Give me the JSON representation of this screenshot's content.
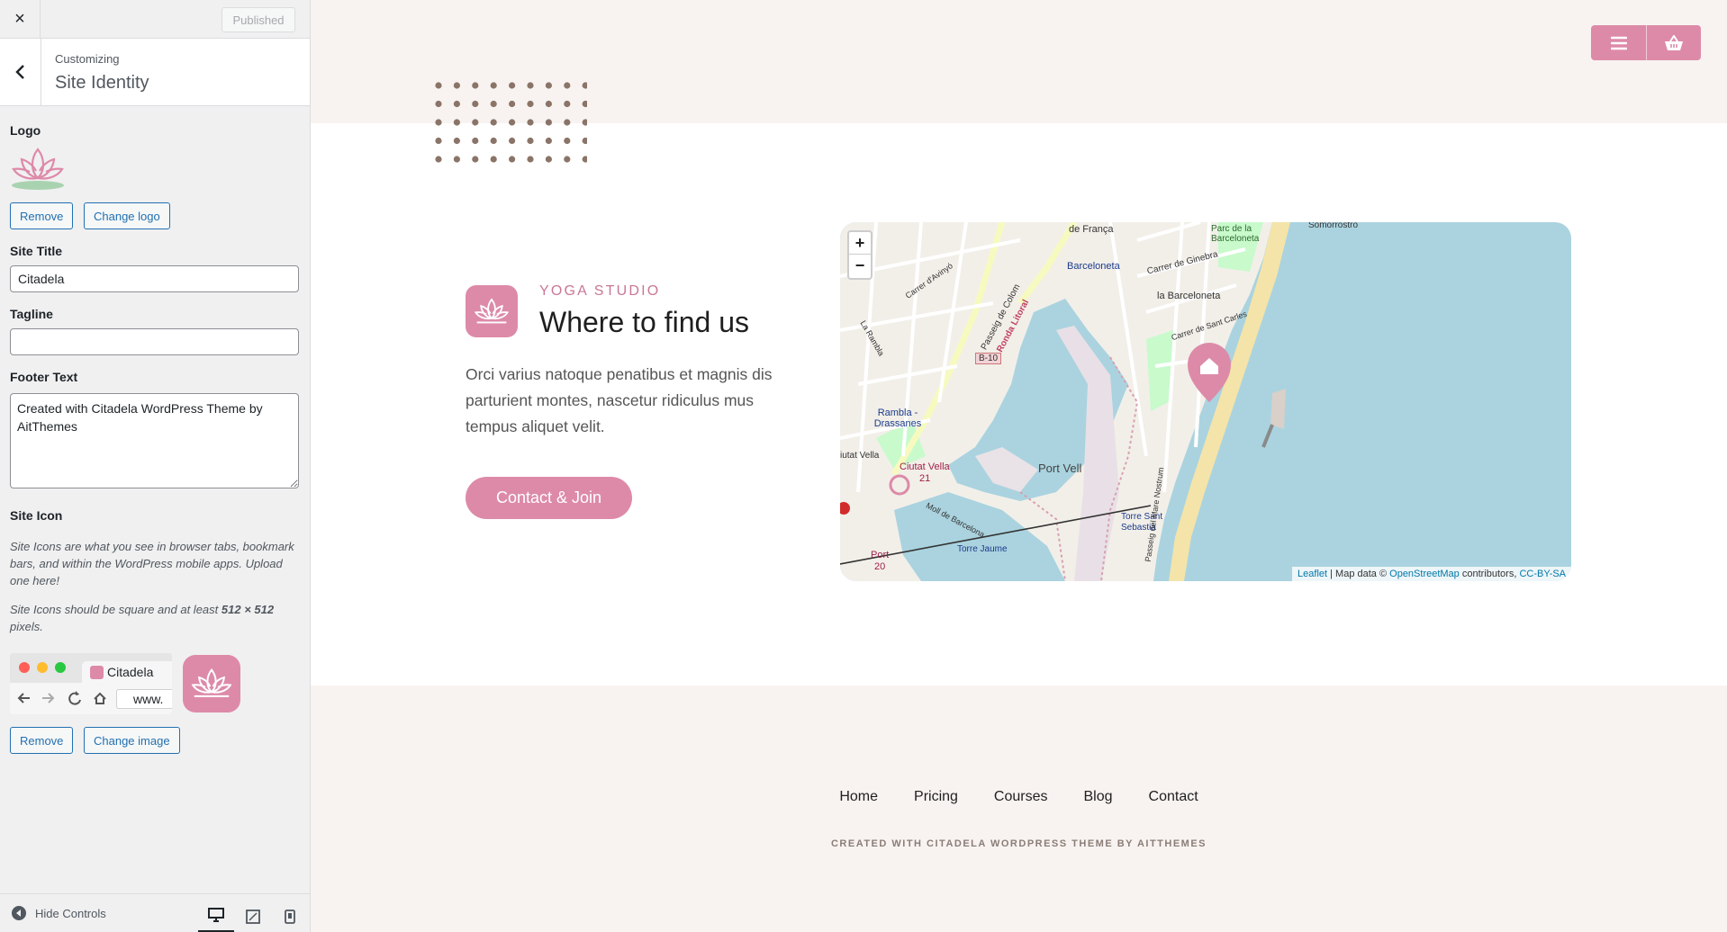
{
  "sidebar": {
    "close_label": "×",
    "published_label": "Published",
    "customizing_label": "Customizing",
    "section_name": "Site Identity",
    "logo_label": "Logo",
    "remove_logo_label": "Remove",
    "change_logo_label": "Change logo",
    "site_title_label": "Site Title",
    "site_title_value": "Citadela",
    "tagline_label": "Tagline",
    "tagline_value": "",
    "footer_text_label": "Footer Text",
    "footer_text_value": "Created with Citadela WordPress Theme by AitThemes",
    "site_icon_label": "Site Icon",
    "site_icon_desc": "Site Icons are what you see in browser tabs, bookmark bars, and within the WordPress mobile apps. Upload one here!",
    "site_icon_size_prefix": "Site Icons should be square and at least ",
    "site_icon_size_value": "512 × 512",
    "site_icon_size_suffix": " pixels.",
    "browser_tab_title": "Citadela",
    "browser_url": "www.",
    "remove_icon_label": "Remove",
    "change_image_label": "Change image",
    "hide_controls_label": "Hide Controls"
  },
  "preview": {
    "eyebrow": "YOGA STUDIO",
    "heading": "Where to find us",
    "body": "Orci varius natoque penatibus et magnis dis parturient montes, nascetur ridiculus mus tempus aliquet velit.",
    "cta_label": "Contact & Join",
    "map": {
      "zoom_in": "+",
      "zoom_out": "−",
      "labels": {
        "top": "de França",
        "barceloneta_station": "Barceloneta",
        "ginebra": "Carrer de Ginebra",
        "parc": "Parc de la Barceloneta",
        "somorrostro": "Somorrostro",
        "la_barceloneta": "la Barceloneta",
        "santcarles": "Carrer de Sant Carles",
        "avinyo": "Carrer d'Avinyó",
        "colom": "Passeig de Colom",
        "ronda": "Ronda Litoral",
        "rambla": "La Rambla",
        "b10": "B-10",
        "drassanes": "Rambla - Drassanes",
        "port_vell": "Port Vell",
        "ciutat_vella": "Ciutat Vella",
        "ciutat_vella_num": "21",
        "torre_sebastia": "Torre Sant Sebastià",
        "torre_jaume": "Torre Jaume",
        "moll": "Moll de Barcelona",
        "mare_nostrum": "Passeig del Mare Nostrum",
        "port": "Port",
        "port_num": "20",
        "vella_left": "iutat Vella"
      },
      "attribution_leaflet": "Leaflet",
      "attribution_mid": " | Map data © ",
      "attribution_osm": "OpenStreetMap",
      "attribution_contrib": " contributors, ",
      "attribution_license": "CC-BY-SA"
    },
    "nav": [
      "Home",
      "Pricing",
      "Courses",
      "Blog",
      "Contact"
    ],
    "footer_credit": "CREATED WITH CITADELA WORDPRESS THEME BY AITTHEMES"
  },
  "colors": {
    "accent_pink": "#dd8aa8",
    "wp_blue": "#2271b1",
    "water": "#aad3df",
    "band_bg": "#f8f3f1"
  },
  "icons": {
    "close": "close-icon",
    "back": "chevron-left-icon",
    "logo": "lotus-icon",
    "menu": "hamburger-menu-icon",
    "cart": "shopping-basket-icon",
    "marker": "home-marker-icon",
    "hide": "collapse-arrow-icon",
    "desktop": "desktop-icon",
    "tablet": "tablet-icon",
    "mobile": "mobile-icon"
  }
}
